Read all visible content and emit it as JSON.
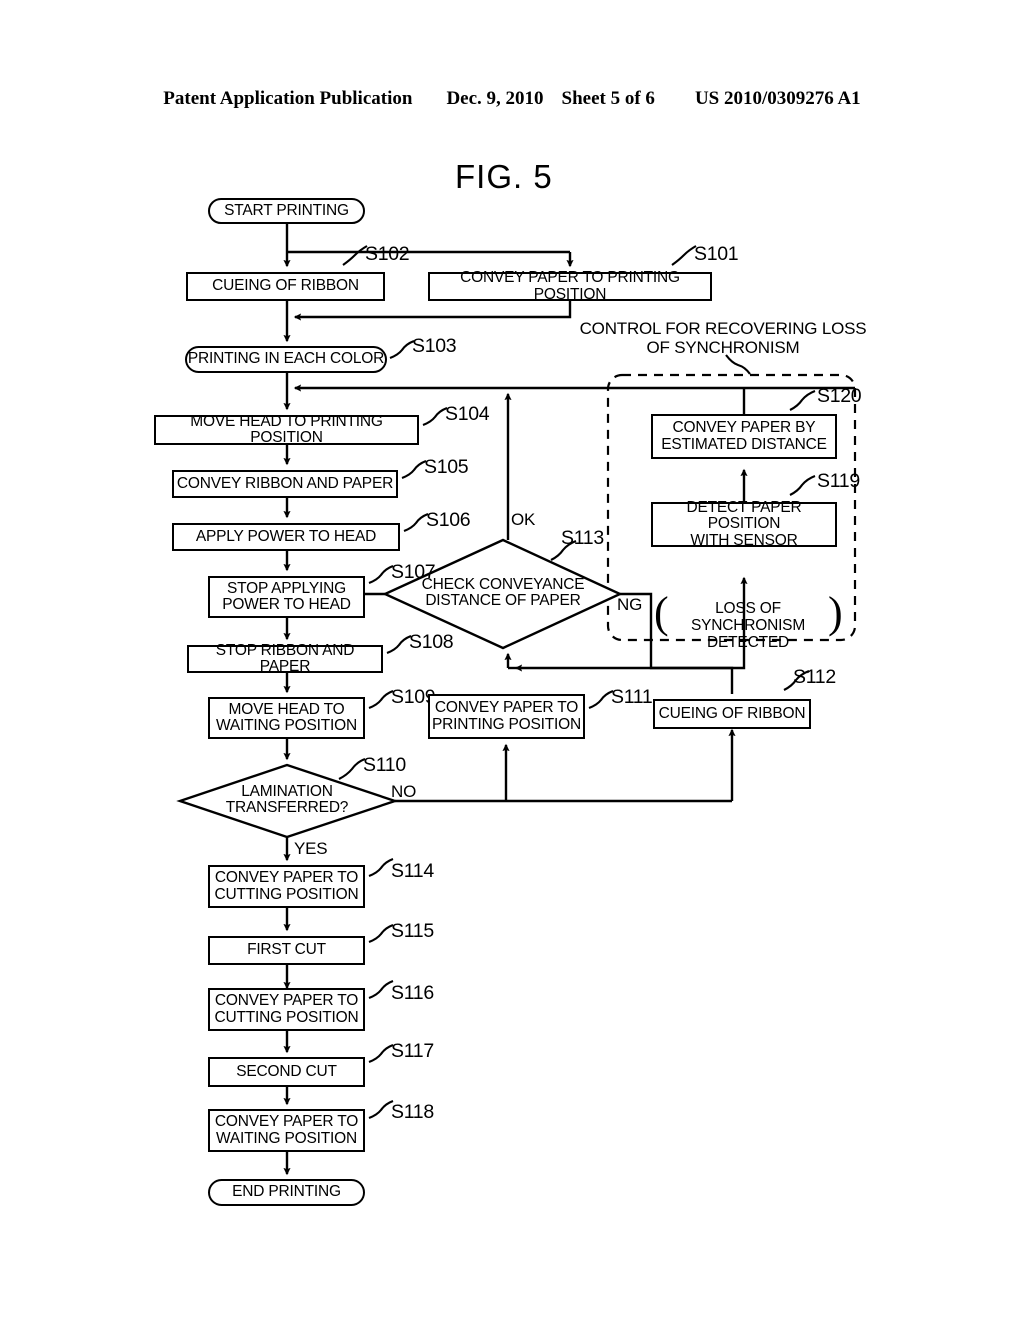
{
  "header": {
    "publication": "Patent Application Publication",
    "date": "Dec. 9, 2010",
    "sheet": "Sheet 5 of 6",
    "patent_number": "US 2010/0309276 A1"
  },
  "figure": {
    "title": "FIG. 5"
  },
  "nodes": {
    "start": {
      "label": "START PRINTING",
      "tag": ""
    },
    "s102": {
      "label": "CUEING OF RIBBON",
      "tag": "S102"
    },
    "s101": {
      "label": "CONVEY PAPER TO PRINTING POSITION",
      "tag": "S101"
    },
    "s103": {
      "label": "PRINTING IN EACH COLOR",
      "tag": "S103"
    },
    "s104": {
      "label": "MOVE HEAD TO PRINTING POSITION",
      "tag": "S104"
    },
    "s105": {
      "label": "CONVEY RIBBON AND PAPER",
      "tag": "S105"
    },
    "s106": {
      "label": "APPLY POWER TO HEAD",
      "tag": "S106"
    },
    "s107": {
      "label": "STOP APPLYING\nPOWER TO HEAD",
      "tag": "S107"
    },
    "s108": {
      "label": "STOP RIBBON AND PAPER",
      "tag": "S108"
    },
    "s109": {
      "label": "MOVE HEAD TO\nWAITING POSITION",
      "tag": "S109"
    },
    "s110": {
      "label": "LAMINATION\nTRANSFERRED?",
      "tag": "S110"
    },
    "s111": {
      "label": "CONVEY PAPER TO\nPRINTING POSITION",
      "tag": "S111"
    },
    "s112": {
      "label": "CUEING OF RIBBON",
      "tag": "S112"
    },
    "s113": {
      "label": "CHECK CONVEYANCE\nDISTANCE OF PAPER",
      "tag": "S113"
    },
    "s114": {
      "label": "CONVEY PAPER TO\nCUTTING POSITION",
      "tag": "S114"
    },
    "s115": {
      "label": "FIRST CUT",
      "tag": "S115"
    },
    "s116": {
      "label": "CONVEY PAPER TO\nCUTTING POSITION",
      "tag": "S116"
    },
    "s117": {
      "label": "SECOND CUT",
      "tag": "S117"
    },
    "s118": {
      "label": "CONVEY PAPER TO\nWAITING POSITION",
      "tag": "S118"
    },
    "s119": {
      "label": "DETECT PAPER POSITION\nWITH SENSOR",
      "tag": "S119"
    },
    "s120": {
      "label": "CONVEY PAPER BY\nESTIMATED DISTANCE",
      "tag": "S120"
    },
    "end": {
      "label": "END PRINTING",
      "tag": ""
    }
  },
  "edge_labels": {
    "ok": "OK",
    "ng": "NG",
    "no": "NO",
    "yes": "YES"
  },
  "annotations": {
    "recovery_group": "CONTROL FOR RECOVERING LOSS\nOF SYNCHRONISM",
    "loss_detected": "LOSS OF SYNCHRONISM\nDETECTED",
    "paren_open": "(",
    "paren_close": ")"
  },
  "colors": {
    "ink": "#000000",
    "paper": "#ffffff"
  }
}
